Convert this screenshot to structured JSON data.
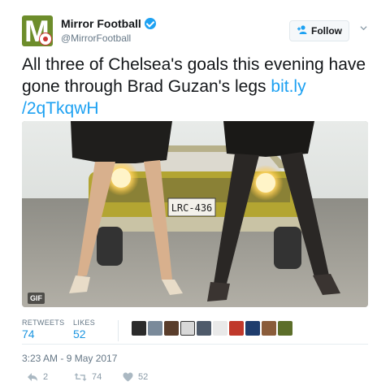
{
  "header": {
    "name": "Mirror Football",
    "handle": "@MirrorFootball",
    "follow_label": "Follow"
  },
  "tweet": {
    "text": "All three of Chelsea's goals this evening have gone through Brad Guzan's legs",
    "link_line1": "bit.ly",
    "link_line2": "/2qTkqwH"
  },
  "media": {
    "badge": "GIF",
    "plate": "LRC-436"
  },
  "stats": {
    "retweets_label": "RETWEETS",
    "retweets_value": "74",
    "likes_label": "LIKES",
    "likes_value": "52"
  },
  "timestamp": "3:23 AM - 9 May 2017",
  "actions": {
    "reply_count": "2",
    "retweet_count": "74",
    "like_count": "52"
  },
  "colors": {
    "accent": "#1da1f2",
    "avatar_bg": "#6d8d2b"
  }
}
